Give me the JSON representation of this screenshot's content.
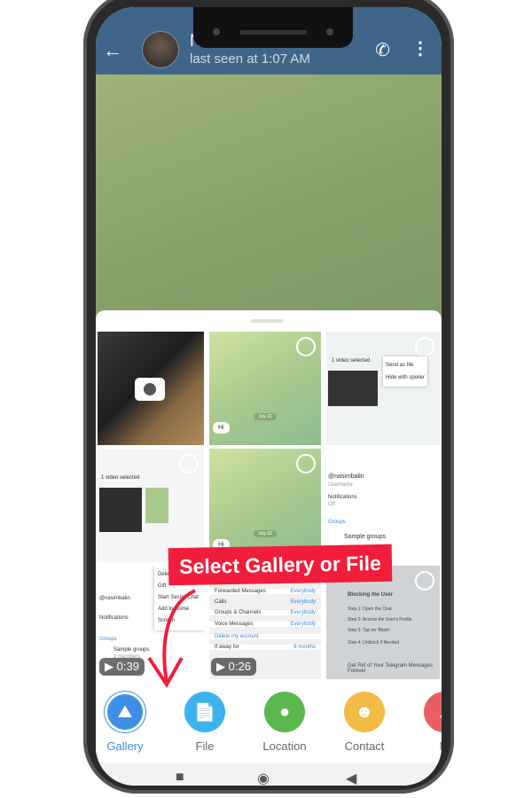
{
  "header": {
    "contact_name": "Nasim",
    "status": "last seen at 1:07 AM"
  },
  "gallery": {
    "thumbs": [
      {
        "kind": "camera"
      },
      {
        "kind": "chat",
        "bubble": "Hi",
        "date": "July 22"
      },
      {
        "kind": "screenshot",
        "title": "1 video selected",
        "menu": [
          "Send as file",
          "Hide with spoiler"
        ]
      },
      {
        "kind": "screenshot",
        "title": "1 video selected"
      },
      {
        "kind": "chat",
        "bubble": "Hi",
        "date": "July 22"
      },
      {
        "kind": "profile",
        "username": "@nasimbalin",
        "username_label": "Username",
        "notifications": "Notifications",
        "notif_value": "Off",
        "groups": "Groups",
        "group_name": "Sample groups"
      },
      {
        "kind": "profile-menu",
        "menu": [
          "Delete",
          "Gift",
          "Start Secret Chat",
          "Add to Home Screen"
        ],
        "username": "@nasimbalin",
        "notifications": "Notifications",
        "groups": "Groups",
        "group_name": "Sample groups",
        "group_sub": "2 members",
        "duration": "0:39"
      },
      {
        "kind": "privacy",
        "rows": [
          {
            "label": "Forwarded Messages",
            "value": "Everybody"
          },
          {
            "label": "Calls",
            "value": "Everybody"
          },
          {
            "label": "Groups & Channels",
            "value": "Everybody"
          },
          {
            "label": "Voice Messages",
            "value": "Everybody"
          }
        ],
        "delete_title": "Delete my account",
        "away_label": "If away for",
        "away_value": "6 months",
        "duration": "0:26"
      },
      {
        "kind": "article",
        "heading": "Blocking the User",
        "steps": [
          "Step 1: Open the Chat",
          "Step 2: Access the User's Profile",
          "Step 3: Tap on 'Block'",
          "Step 4: Unblock if Needed"
        ],
        "footer": "Get Rid of Your Telegram Messages Forever"
      }
    ]
  },
  "annotation": {
    "banner": "Select Gallery or File",
    "color": "#f21d3b"
  },
  "attach_bar": {
    "items": [
      {
        "label": "Gallery",
        "icon": "gallery-icon",
        "color": "#3d8ee6",
        "active": true
      },
      {
        "label": "File",
        "icon": "file-icon",
        "color": "#3db3ee"
      },
      {
        "label": "Location",
        "icon": "location-pin-icon",
        "color": "#5bb750"
      },
      {
        "label": "Contact",
        "icon": "contact-icon",
        "color": "#f2bb45"
      },
      {
        "label": "M",
        "icon": "music-icon",
        "color": "#e85f63"
      }
    ]
  },
  "colors": {
    "header": "#3f6688",
    "accent": "#3d8ee6"
  }
}
